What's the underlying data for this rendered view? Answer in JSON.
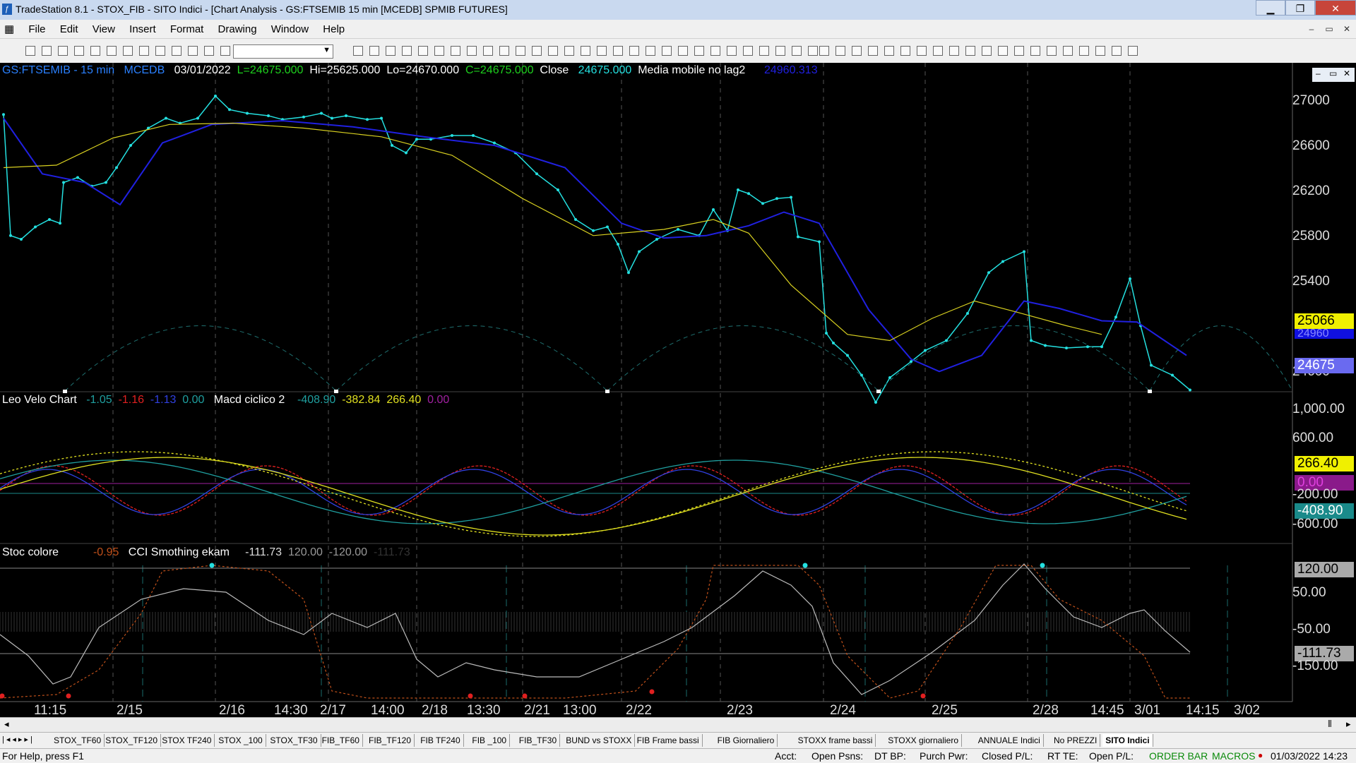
{
  "window": {
    "title": "TradeStation 8.1 - STOX_FIB - SITO Indici - [Chart Analysis - GS:FTSEMIB  15 min  [MCEDB] SPMIB FUTURES]",
    "app_icon": "tradestation-logo-icon",
    "min": "▁",
    "max": "❐",
    "close": "✕"
  },
  "menu": [
    "File",
    "Edit",
    "View",
    "Insert",
    "Format",
    "Drawing",
    "Window",
    "Help"
  ],
  "mdi_buttons": [
    "–",
    "▭",
    "✕"
  ],
  "inner_mdi_buttons": [
    "–",
    "▭",
    "✕"
  ],
  "price_header": {
    "symbol": "GS:FTSEMIB - 15 min",
    "code": "MCEDB",
    "date": "03/01/2022",
    "last": "L=24675.000",
    "high": "Hi=25625.000",
    "low": "Lo=24670.000",
    "close": "C=24675.000",
    "close_label": "Close",
    "close_value": "24675.000",
    "ma_label": "Media mobile no lag2",
    "ma_value": "24960.313"
  },
  "macd_header": {
    "name": "Leo Velo Chart",
    "v1": "-1.05",
    "v2": "-1.16",
    "v3": "-1.13",
    "v4": "0.00",
    "name2": "Macd ciclico 2",
    "v5": "-408.90",
    "v6": "-382.84",
    "v7": "266.40",
    "v8": "0.00"
  },
  "stoc_header": {
    "name": "Stoc colore",
    "v1": "-0.95",
    "name2": "CCI Smothing ekam",
    "v2": "-111.73",
    "v3": "120.00",
    "v4": "-120.00",
    "v5": "-111.73"
  },
  "price_scale": [
    "27000",
    "26600",
    "26200",
    "25800",
    "25400",
    "25000",
    "24600"
  ],
  "price_tags": {
    "yellow": "25066",
    "blue": "24960",
    "last": "24675"
  },
  "macd_scale": [
    "1,000.00",
    "600.00",
    "-200.00",
    "-600.00"
  ],
  "macd_tags": {
    "yellow": "266.40",
    "purple": "0.00",
    "teal": "-408.90"
  },
  "stoc_scale": [
    "50.00",
    "-50.00",
    "-150.00"
  ],
  "stoc_tags": {
    "top": "120.00",
    "last": "-111.73"
  },
  "x_labels": [
    "11:15",
    "2/15",
    "2/16",
    "14:30",
    "2/17",
    "14:00",
    "2/18",
    "13:30",
    "2/21",
    "13:00",
    "2/22",
    "2/23",
    "2/24",
    "2/25",
    "2/28",
    "14:45",
    "3/01",
    "14:15",
    "3/02"
  ],
  "tabs": [
    "STOX_TF60",
    "STOX_TF120",
    "STOX TF240",
    "STOX _100",
    "STOX_TF30",
    "FIB_TF60",
    "FIB_TF120",
    "FIB TF240",
    "FIB _100",
    "FIB_TF30",
    "BUND vs STOXX",
    "FIB Frame bassi",
    "FIB Giornaliero",
    "STOXX frame bassi",
    "STOXX giornaliero",
    "ANNUALE Indici",
    "No PREZZI",
    "SITO Indici"
  ],
  "status": {
    "help": "For Help, press F1",
    "acct": "Acct:",
    "open_psns": "Open Psns:",
    "dt_bp": "DT BP:",
    "purch_pwr": "Purch Pwr:",
    "closed_pl": "Closed P/L:",
    "rt_te": "RT TE:",
    "open_pl": "Open P/L:",
    "order_bar": "ORDER BAR",
    "macros": "MACROS",
    "datetime": "01/03/2022 14:23"
  },
  "colors": {
    "cyan": "#24e0e0",
    "blue_ma": "#2020e0",
    "yellow_ma": "#d8d020",
    "macd_teal": "#1f9f9f",
    "macd_yellow": "#e0e020",
    "stoc_orange": "#c0501a"
  }
}
